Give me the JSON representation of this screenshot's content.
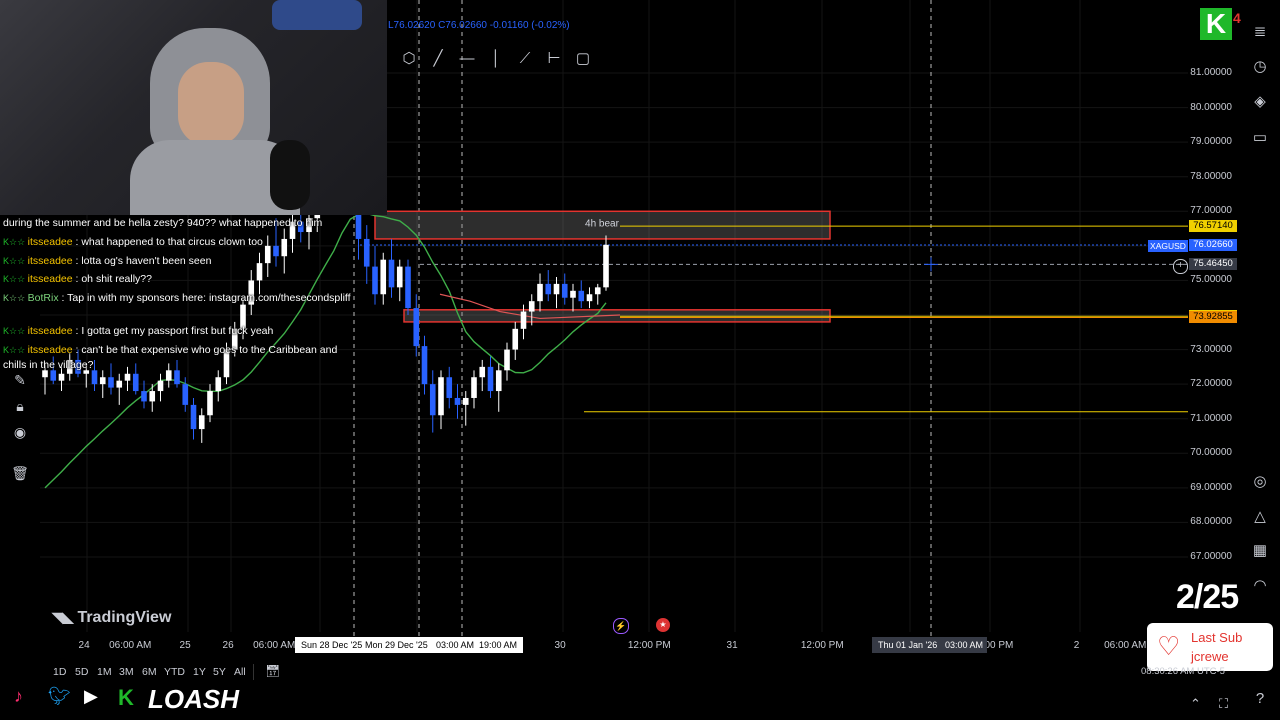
{
  "header": {
    "ohlc_low": "L76.02620",
    "ohlc_close": "C76.02660",
    "ohlc_change": "-0.01160 (-0.02%)"
  },
  "chart_data": {
    "type": "candlestick",
    "symbol": "XAGUSD",
    "ylim": [
      66.5,
      82
    ],
    "price_ticks": [
      "81.00000",
      "80.00000",
      "79.00000",
      "78.00000",
      "77.00000",
      "75.00000",
      "73.00000",
      "72.00000",
      "71.00000",
      "70.00000",
      "69.00000",
      "68.00000",
      "67.00000"
    ],
    "price_tags": [
      {
        "text": "76.57140",
        "price": 76.5714,
        "bg": "#f0d000",
        "fg": "#000000"
      },
      {
        "text": "76.02660",
        "price": 76.0266,
        "bg": "#2962ff",
        "fg": "#ffffff"
      },
      {
        "text": "75.46450",
        "price": 75.4645,
        "bg": "#363a45",
        "fg": "#ffffff"
      },
      {
        "text": "73.96335",
        "price": 73.96335,
        "bg": "#f0d000",
        "fg": "#000000"
      },
      {
        "text": "73.92855",
        "price": 73.92855,
        "bg": "#f08c00",
        "fg": "#000000"
      }
    ],
    "symbol_tag": "XAGUSD",
    "zones": [
      {
        "label": "4h bear",
        "top": 77.0,
        "bottom": 76.2
      },
      {
        "label": "",
        "top": 74.15,
        "bottom": 73.8
      }
    ],
    "hlines": [
      76.5714,
      73.96335,
      73.92855,
      71.2
    ],
    "time_ticks": [
      "24",
      "06:00 AM",
      "25",
      "26",
      "06:00 AM",
      "30",
      "12:00 PM",
      "31",
      "12:00 PM",
      "00 PM",
      "2",
      "06:00 AM"
    ],
    "highlighted_times": [
      "Sun 28 Dec '25",
      "Mon 29 Dec '25",
      "03:00 AM",
      "19:00 AM"
    ],
    "crosshair_time": [
      "Thu 01 Jan '26",
      "03:00 AM"
    ],
    "candles": [
      {
        "o": 72.2,
        "h": 72.6,
        "l": 71.7,
        "c": 72.4
      },
      {
        "o": 72.4,
        "h": 72.8,
        "l": 72.0,
        "c": 72.1
      },
      {
        "o": 72.1,
        "h": 72.5,
        "l": 71.8,
        "c": 72.3
      },
      {
        "o": 72.3,
        "h": 72.9,
        "l": 72.1,
        "c": 72.7
      },
      {
        "o": 72.7,
        "h": 73.0,
        "l": 72.2,
        "c": 72.3
      },
      {
        "o": 72.3,
        "h": 72.6,
        "l": 71.9,
        "c": 72.4
      },
      {
        "o": 72.4,
        "h": 72.7,
        "l": 71.8,
        "c": 72.0
      },
      {
        "o": 72.0,
        "h": 72.4,
        "l": 71.6,
        "c": 72.2
      },
      {
        "o": 72.2,
        "h": 72.6,
        "l": 71.7,
        "c": 71.9
      },
      {
        "o": 71.9,
        "h": 72.3,
        "l": 71.4,
        "c": 72.1
      },
      {
        "o": 72.1,
        "h": 72.5,
        "l": 71.8,
        "c": 72.3
      },
      {
        "o": 72.3,
        "h": 72.6,
        "l": 71.7,
        "c": 71.8
      },
      {
        "o": 71.8,
        "h": 72.1,
        "l": 71.3,
        "c": 71.5
      },
      {
        "o": 71.5,
        "h": 72.0,
        "l": 71.2,
        "c": 71.8
      },
      {
        "o": 71.8,
        "h": 72.3,
        "l": 71.5,
        "c": 72.1
      },
      {
        "o": 72.1,
        "h": 72.6,
        "l": 71.9,
        "c": 72.4
      },
      {
        "o": 72.4,
        "h": 72.7,
        "l": 71.9,
        "c": 72.0
      },
      {
        "o": 72.0,
        "h": 72.2,
        "l": 71.2,
        "c": 71.4
      },
      {
        "o": 71.4,
        "h": 71.6,
        "l": 70.4,
        "c": 70.7
      },
      {
        "o": 70.7,
        "h": 71.3,
        "l": 70.3,
        "c": 71.1
      },
      {
        "o": 71.1,
        "h": 72.0,
        "l": 70.9,
        "c": 71.8
      },
      {
        "o": 71.8,
        "h": 72.4,
        "l": 71.5,
        "c": 72.2
      },
      {
        "o": 72.2,
        "h": 73.2,
        "l": 72.0,
        "c": 73.0
      },
      {
        "o": 73.0,
        "h": 73.8,
        "l": 72.8,
        "c": 73.6
      },
      {
        "o": 73.6,
        "h": 74.5,
        "l": 73.3,
        "c": 74.3
      },
      {
        "o": 74.3,
        "h": 75.3,
        "l": 74.0,
        "c": 75.0
      },
      {
        "o": 75.0,
        "h": 75.8,
        "l": 74.6,
        "c": 75.5
      },
      {
        "o": 75.5,
        "h": 76.3,
        "l": 75.1,
        "c": 76.0
      },
      {
        "o": 76.0,
        "h": 76.8,
        "l": 75.4,
        "c": 75.7
      },
      {
        "o": 75.7,
        "h": 76.5,
        "l": 75.2,
        "c": 76.2
      },
      {
        "o": 76.2,
        "h": 77.0,
        "l": 75.8,
        "c": 76.7
      },
      {
        "o": 76.7,
        "h": 77.2,
        "l": 76.1,
        "c": 76.4
      },
      {
        "o": 76.4,
        "h": 77.0,
        "l": 75.9,
        "c": 76.8
      },
      {
        "o": 76.8,
        "h": 77.6,
        "l": 76.4,
        "c": 77.3
      },
      {
        "o": 77.3,
        "h": 78.0,
        "l": 76.9,
        "c": 77.6
      },
      {
        "o": 77.6,
        "h": 78.4,
        "l": 77.2,
        "c": 77.9
      },
      {
        "o": 77.9,
        "h": 80.6,
        "l": 77.7,
        "c": 80.2
      },
      {
        "o": 80.2,
        "h": 80.5,
        "l": 79.0,
        "c": 79.2
      },
      {
        "o": 79.2,
        "h": 79.6,
        "l": 75.6,
        "c": 76.2
      },
      {
        "o": 76.2,
        "h": 76.6,
        "l": 74.9,
        "c": 75.4
      },
      {
        "o": 75.4,
        "h": 76.0,
        "l": 74.3,
        "c": 74.6
      },
      {
        "o": 74.6,
        "h": 75.8,
        "l": 74.3,
        "c": 75.6
      },
      {
        "o": 75.6,
        "h": 76.2,
        "l": 74.5,
        "c": 74.8
      },
      {
        "o": 74.8,
        "h": 75.6,
        "l": 74.4,
        "c": 75.4
      },
      {
        "o": 75.4,
        "h": 75.6,
        "l": 74.0,
        "c": 74.2
      },
      {
        "o": 74.2,
        "h": 74.6,
        "l": 72.8,
        "c": 73.1
      },
      {
        "o": 73.1,
        "h": 73.4,
        "l": 71.7,
        "c": 72.0
      },
      {
        "o": 72.0,
        "h": 72.4,
        "l": 70.6,
        "c": 71.1
      },
      {
        "o": 71.1,
        "h": 72.4,
        "l": 70.7,
        "c": 72.2
      },
      {
        "o": 72.2,
        "h": 72.5,
        "l": 71.3,
        "c": 71.6
      },
      {
        "o": 71.6,
        "h": 72.0,
        "l": 71.0,
        "c": 71.4
      },
      {
        "o": 71.4,
        "h": 71.8,
        "l": 70.8,
        "c": 71.6
      },
      {
        "o": 71.6,
        "h": 72.4,
        "l": 71.3,
        "c": 72.2
      },
      {
        "o": 72.2,
        "h": 72.7,
        "l": 71.8,
        "c": 72.5
      },
      {
        "o": 72.5,
        "h": 72.8,
        "l": 71.6,
        "c": 71.8
      },
      {
        "o": 71.8,
        "h": 72.6,
        "l": 71.2,
        "c": 72.4
      },
      {
        "o": 72.4,
        "h": 73.2,
        "l": 72.1,
        "c": 73.0
      },
      {
        "o": 73.0,
        "h": 73.8,
        "l": 72.7,
        "c": 73.6
      },
      {
        "o": 73.6,
        "h": 74.3,
        "l": 73.3,
        "c": 74.1
      },
      {
        "o": 74.1,
        "h": 74.6,
        "l": 73.7,
        "c": 74.4
      },
      {
        "o": 74.4,
        "h": 75.2,
        "l": 74.1,
        "c": 74.9
      },
      {
        "o": 74.9,
        "h": 75.3,
        "l": 74.4,
        "c": 74.6
      },
      {
        "o": 74.6,
        "h": 75.1,
        "l": 74.2,
        "c": 74.9
      },
      {
        "o": 74.9,
        "h": 75.2,
        "l": 74.3,
        "c": 74.5
      },
      {
        "o": 74.5,
        "h": 74.9,
        "l": 74.1,
        "c": 74.7
      },
      {
        "o": 74.7,
        "h": 75.0,
        "l": 74.2,
        "c": 74.4
      },
      {
        "o": 74.4,
        "h": 74.8,
        "l": 74.2,
        "c": 74.6
      },
      {
        "o": 74.6,
        "h": 74.9,
        "l": 74.3,
        "c": 74.8
      },
      {
        "o": 74.8,
        "h": 76.3,
        "l": 74.7,
        "c": 76.03
      }
    ]
  },
  "timeframes": [
    "1D",
    "5D",
    "1M",
    "3M",
    "6M",
    "YTD",
    "1Y",
    "5Y",
    "All"
  ],
  "watermark": "TradingView",
  "chat": [
    {
      "user": "",
      "msg": "during the summer and be hella zesty? 940?? what happened to him",
      "bot": false
    },
    {
      "user": "itsseadee",
      "msg": " : what happened to that circus clown too",
      "bot": false
    },
    {
      "user": "itsseadee",
      "msg": " : lotta og's haven't been seen",
      "bot": false
    },
    {
      "user": "itsseadee",
      "msg": " : oh shit really??",
      "bot": false
    },
    {
      "user": "BotRix",
      "msg": " : Tap in with my sponsors here: instagram.com/thesecondspliff",
      "bot": true
    },
    {
      "user": "itsseadee",
      "msg": " : I gotta get my passport first but fuck yeah",
      "bot": false
    },
    {
      "user": "itsseadee",
      "msg": " : can't be that expensive who goes to the Caribbean and",
      "bot": false
    },
    {
      "user": "",
      "msg": "chills in the village?",
      "bot": false
    }
  ],
  "stream": {
    "counter": "2/25",
    "last_sub_title": "Last Sub",
    "last_sub_name": "jcrewe",
    "brand": "LOASH",
    "badge_count": "4",
    "bottom_right_time": "08:30:26 AM UTC-5"
  },
  "colors": {
    "up": "#ffffff",
    "down": "#2962ff",
    "ma": "#3fae49",
    "zone": "#e3342f",
    "hline": "#f0d000",
    "bg": "#000000",
    "grid": "#1a1a1a"
  }
}
